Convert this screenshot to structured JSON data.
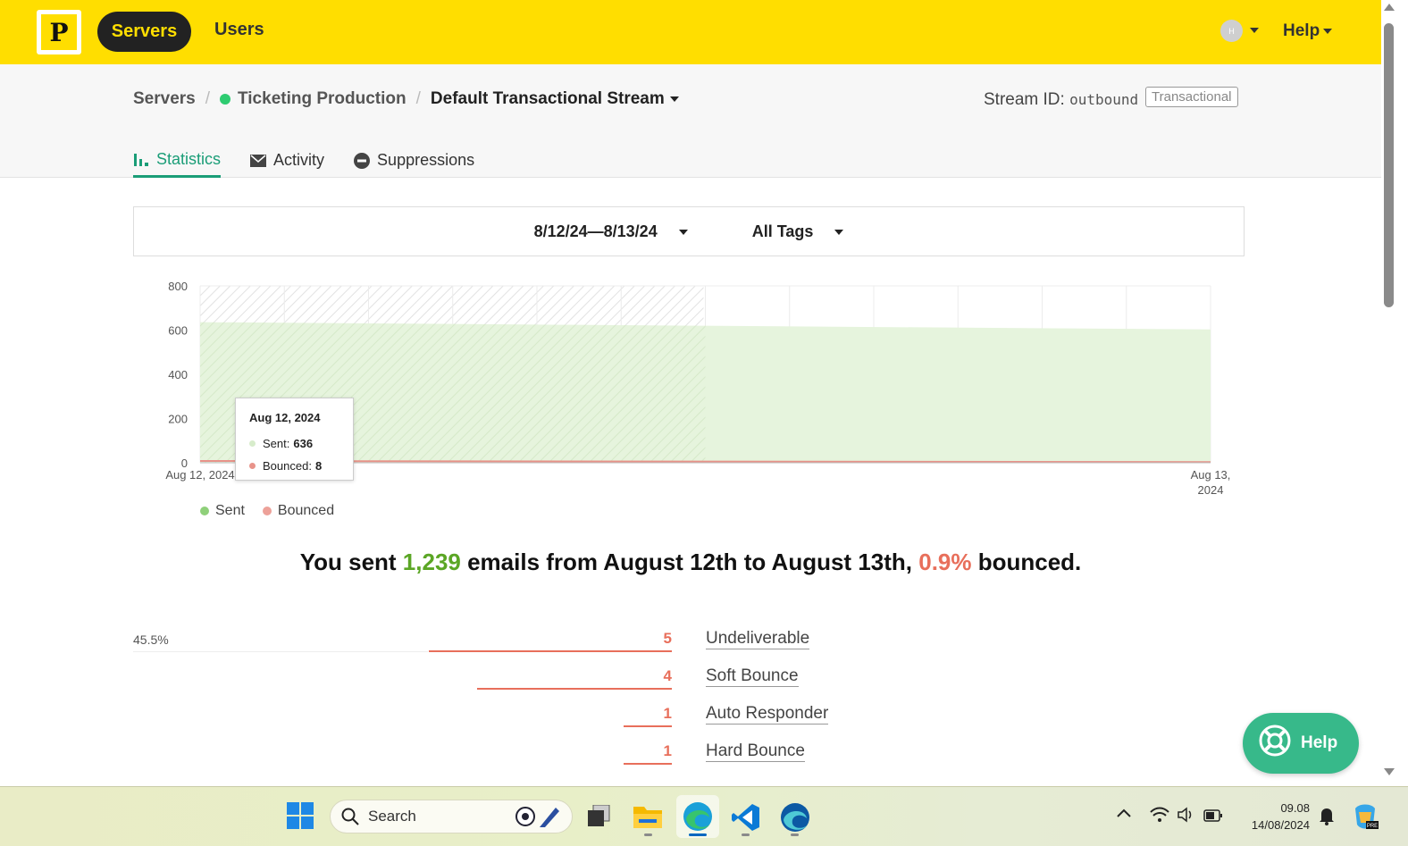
{
  "topbar": {
    "logo_letter": "P",
    "nav": [
      {
        "label": "Servers",
        "active": true
      },
      {
        "label": "Users",
        "active": false
      }
    ],
    "avatar_initial": "H",
    "help_label": "Help",
    "accent_color": "#ffde00"
  },
  "breadcrumb": {
    "root": "Servers",
    "server": "Ticketing Production",
    "stream": "Default Transactional Stream"
  },
  "stream_info": {
    "label": "Stream ID:",
    "id": "outbound",
    "type_badge": "Transactional"
  },
  "tabs": [
    {
      "label": "Statistics",
      "icon": "bar-chart-icon",
      "active": true
    },
    {
      "label": "Activity",
      "icon": "envelope-icon",
      "active": false
    },
    {
      "label": "Suppressions",
      "icon": "minus-circle-icon",
      "active": false
    }
  ],
  "filters": {
    "date_range": "8/12/24—8/13/24",
    "tags": "All Tags"
  },
  "chart_data": {
    "type": "area",
    "x": [
      "Aug 12, 2024",
      "Aug 13, 2024"
    ],
    "x_tick_labels": [
      "Aug 12, 2024",
      "Aug 13,",
      "2024"
    ],
    "series": [
      {
        "name": "Sent",
        "values": [
          636,
          603
        ],
        "color": "#a8d98a"
      },
      {
        "name": "Bounced",
        "values": [
          8,
          3
        ],
        "color": "#e8938a"
      }
    ],
    "y_ticks": [
      "800",
      "600",
      "400",
      "200",
      "0"
    ],
    "ylim": [
      0,
      800
    ],
    "grid": true,
    "legend": "bottom-left",
    "tooltip": {
      "title": "Aug 12, 2024",
      "sent_label": "Sent:",
      "sent_value": "636",
      "bounced_label": "Bounced:",
      "bounced_value": "8"
    }
  },
  "summary": {
    "prefix": "You sent ",
    "sent_count": "1,239",
    "middle": " emails from August 12th to August 13th, ",
    "bounce_rate": "0.9%",
    "suffix": " bounced."
  },
  "bounces": {
    "max_percent": "45.5%",
    "items": [
      {
        "value": "5",
        "label": "Undeliverable",
        "fraction": 1.0
      },
      {
        "value": "4",
        "label": "Soft Bounce",
        "fraction": 0.8
      },
      {
        "value": "1",
        "label": "Auto Responder",
        "fraction": 0.2
      },
      {
        "value": "1",
        "label": "Hard Bounce",
        "fraction": 0.2
      }
    ]
  },
  "help_button": {
    "label": "Help"
  },
  "taskbar": {
    "search_placeholder": "Search",
    "time": "09.08",
    "date": "14/08/2024"
  }
}
